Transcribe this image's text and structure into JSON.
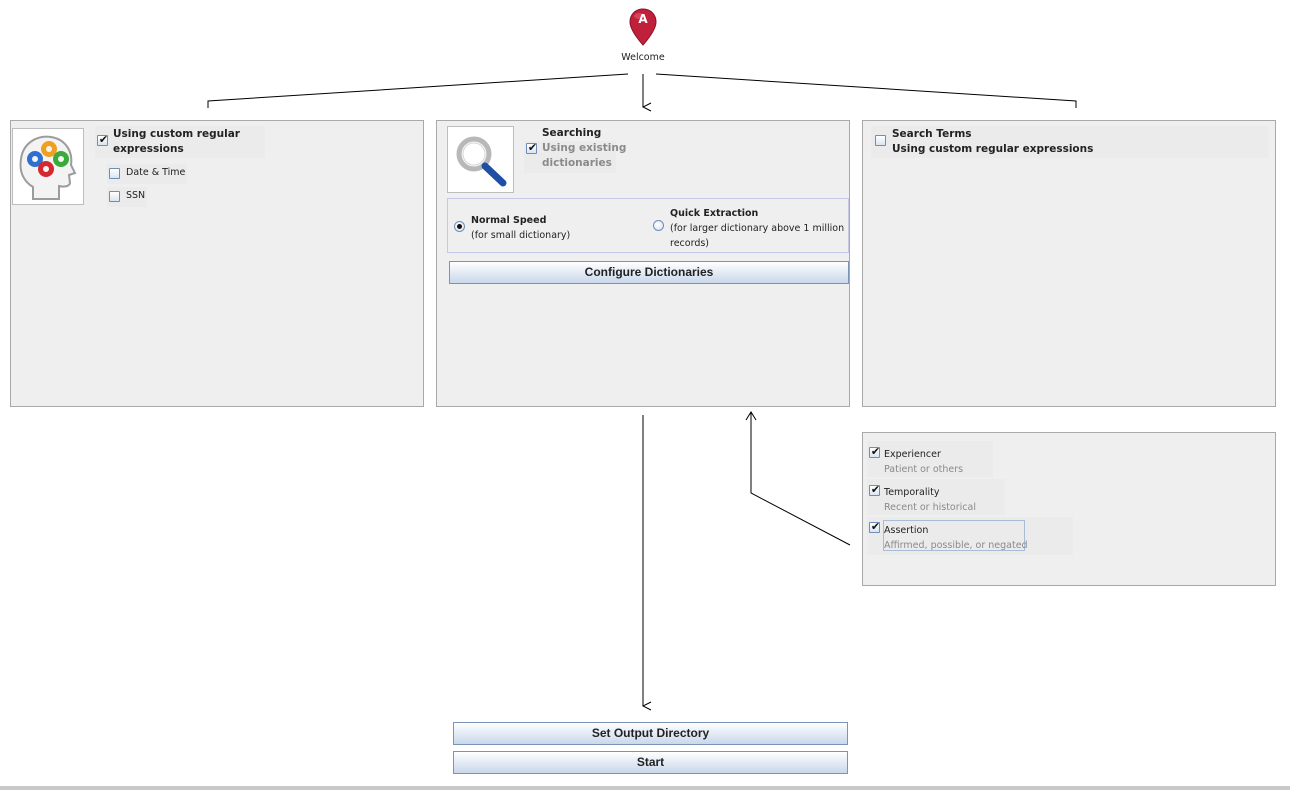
{
  "welcome": {
    "marker_letter": "A",
    "label": "Welcome",
    "marker_color": "#c1203a"
  },
  "left_panel": {
    "icon": "head-gears-icon",
    "main_option": {
      "label_line1": "Using custom regular",
      "label_line2": "expressions",
      "checked": true
    },
    "options": [
      {
        "label": "Date & Time",
        "checked": false
      },
      {
        "label": "SSN",
        "checked": false
      }
    ]
  },
  "middle_panel": {
    "icon": "magnifier-icon",
    "title": "Searching",
    "option": {
      "label_line1": "Using existing",
      "label_line2": "dictionaries",
      "checked": true
    },
    "speed": {
      "normal": {
        "title": "Normal Speed",
        "desc": "(for small dictionary)",
        "selected": true
      },
      "quick": {
        "title": "Quick Extraction",
        "desc_line1": "(for larger dictionary above 1 million",
        "desc_line2": "records)",
        "selected": false
      }
    },
    "configure_button": "Configure Dictionaries"
  },
  "right_panel": {
    "option": {
      "label_line1": "Search Terms",
      "label_line2": "Using custom regular expressions",
      "checked": false
    }
  },
  "context_panel": {
    "items": [
      {
        "label": "Experiencer",
        "desc": "Patient or others",
        "checked": true
      },
      {
        "label": "Temporality",
        "desc": "Recent or historical",
        "checked": true
      },
      {
        "label": "Assertion",
        "desc": "Affirmed, possible, or negated",
        "checked": true
      }
    ]
  },
  "actions": {
    "output_button": "Set Output Directory",
    "start_button": "Start"
  },
  "colors": {
    "accent_border": "#7a93b8",
    "panel_bg": "#efefef",
    "marker": "#c1203a"
  }
}
